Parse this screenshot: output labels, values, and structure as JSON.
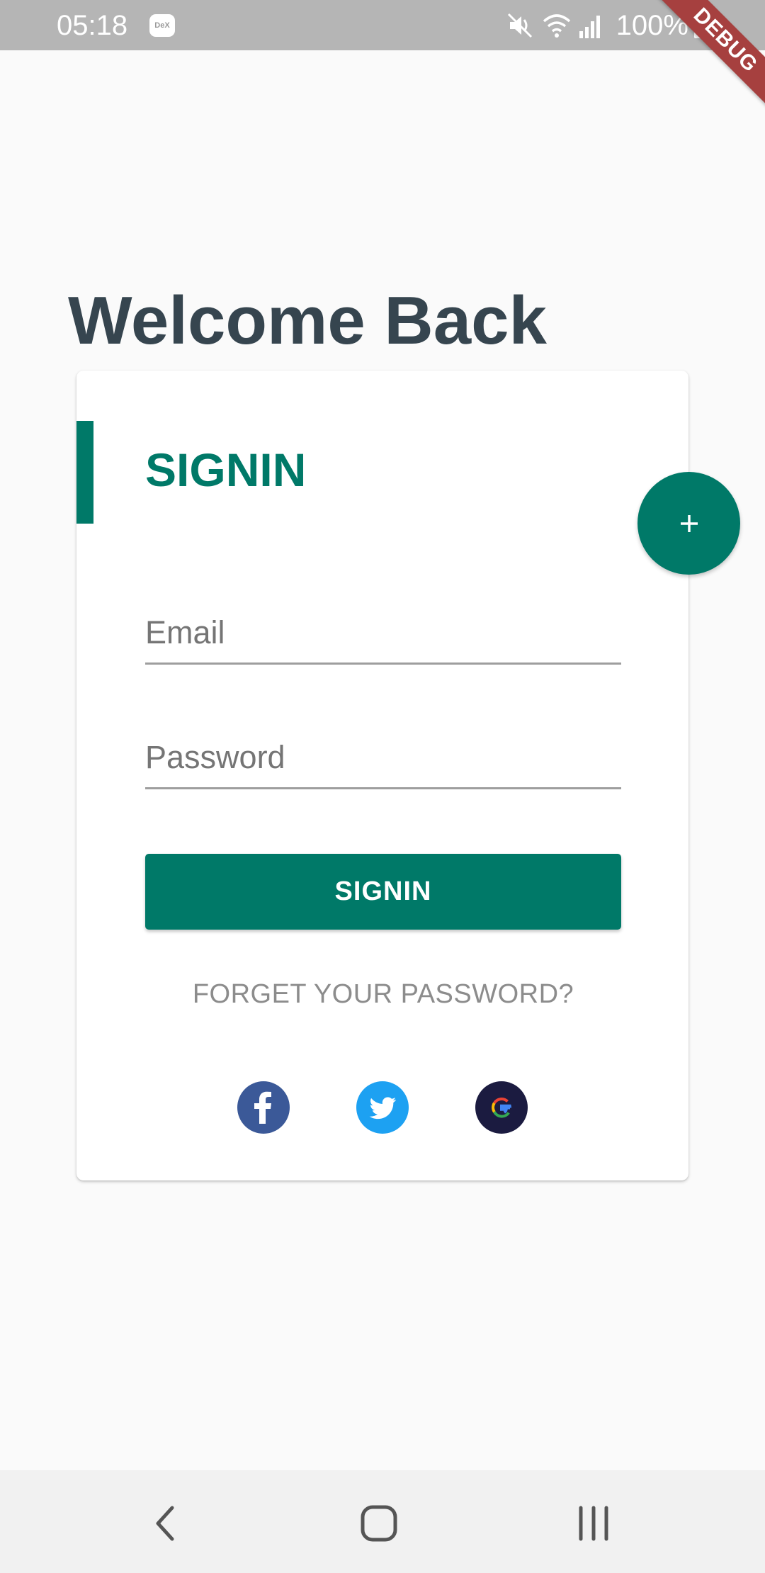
{
  "status_bar": {
    "time": "05:18",
    "dex_badge": "DeX",
    "battery": "100%",
    "icons": [
      "mute-icon",
      "wifi-icon",
      "signal-icon",
      "battery-icon"
    ]
  },
  "debug_banner": "DEBUG",
  "page": {
    "title": "Welcome Back"
  },
  "card": {
    "heading": "SIGNIN",
    "email_placeholder": "Email",
    "password_placeholder": "Password",
    "signin_button": "SIGNIN",
    "forgot_password": "FORGET YOUR PASSWORD?",
    "social": [
      {
        "icon": "facebook-icon",
        "color": "#3b5998"
      },
      {
        "icon": "twitter-icon",
        "color": "#1da1f2"
      },
      {
        "icon": "google-icon",
        "color": "#1b1b40"
      }
    ]
  },
  "fab": {
    "icon": "plus-icon"
  },
  "nav_bar": {
    "icons": [
      "back-icon",
      "home-icon",
      "recents-icon"
    ]
  },
  "colors": {
    "accent": "#007968",
    "title": "#36454f",
    "background": "#fafafa",
    "debug_ribbon": "#a6403f"
  }
}
